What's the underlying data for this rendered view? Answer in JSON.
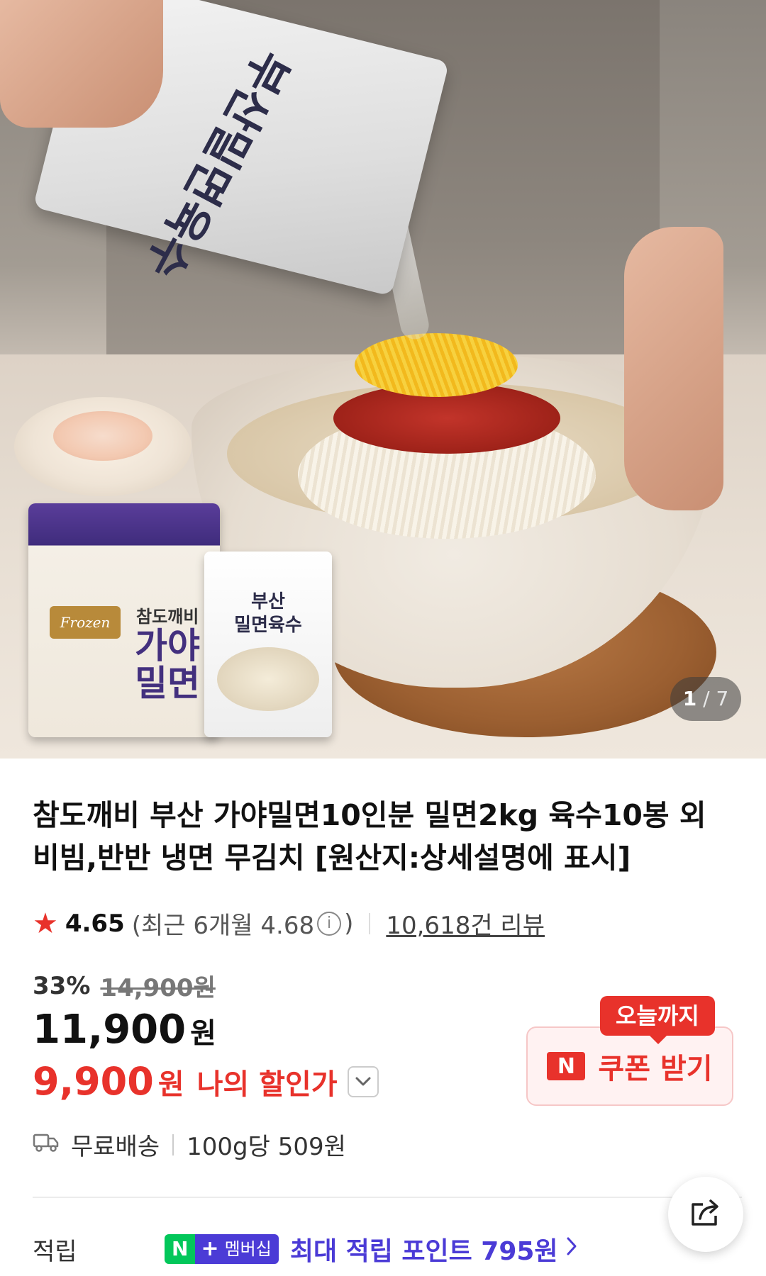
{
  "gallery": {
    "current": "1",
    "separator": "/",
    "total": "7",
    "pouch_label": "부산밀면육수",
    "pkg_blue_small": "참도깨비",
    "pkg_blue_big": "가야\n밀면",
    "pkg_blue_frozen": "Frozen",
    "pkg_white_title": "부산\n밀면육수"
  },
  "product": {
    "title": "참도깨비 부산 가야밀면10인분 밀면2kg 육수10봉 외 비빔,반반 냉면 무김치 [원산지:상세설명에 표시]",
    "rating": "4.65",
    "recent_rating_prefix": "(최근 6개월 4.68",
    "recent_rating_suffix": ")",
    "reviews": "10,618건 리뷰",
    "discount_rate": "33%",
    "original_price": "14,900원",
    "price": "11,900",
    "price_unit": "원",
    "my_price": "9,900",
    "my_price_unit": "원",
    "my_price_label": "나의 할인가"
  },
  "coupon": {
    "badge": "오늘까지",
    "n_logo": "N",
    "label": "쿠폰 받기"
  },
  "delivery": {
    "shipping": "무료배송",
    "unit_price": "100g당 509원"
  },
  "points": {
    "label": "적립",
    "membership_n": "N",
    "membership_plus": "+",
    "membership_text": "멤버십",
    "text": "최대 적립 포인트 795원"
  },
  "colors": {
    "accent_red": "#e8322b",
    "membership_purple": "#4b3bd6",
    "naver_green": "#03c75a"
  },
  "icons": [
    "star-icon",
    "info-icon",
    "chevron-down-icon",
    "truck-icon",
    "share-icon",
    "chevron-right-icon"
  ]
}
